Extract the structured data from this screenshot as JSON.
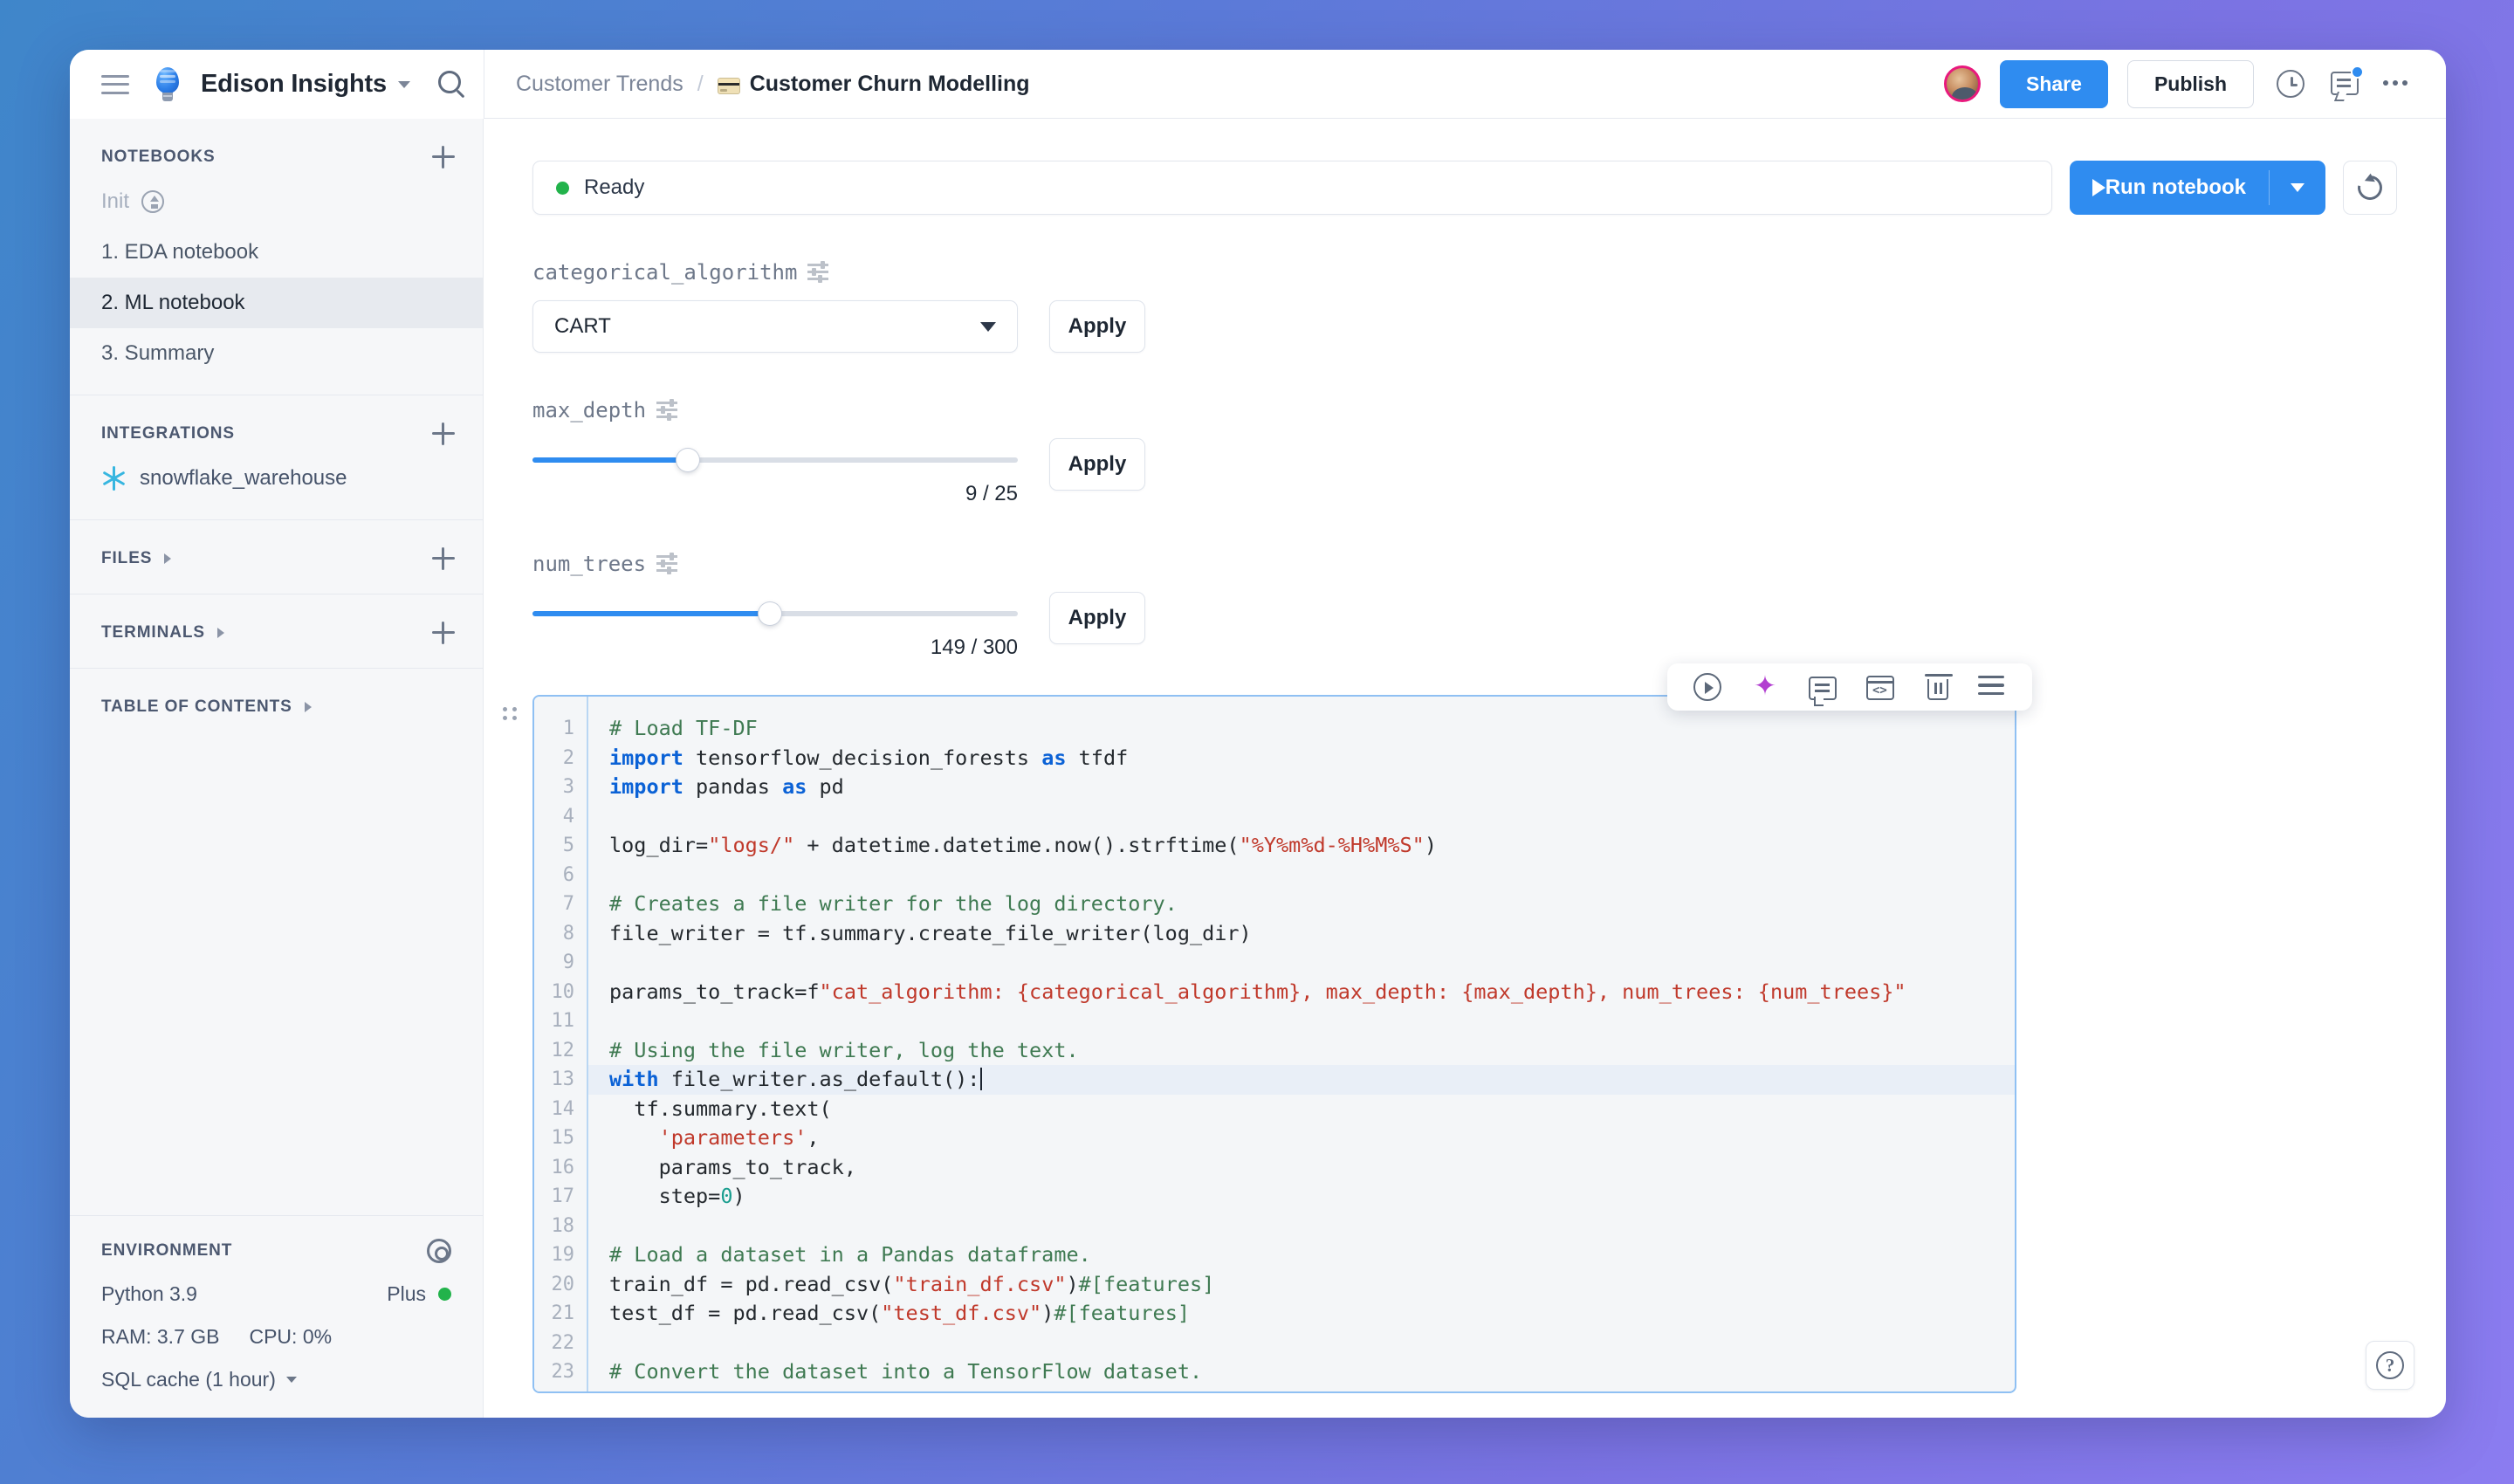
{
  "app": {
    "brand_name": "Edison Insights",
    "logo_icon": "lightbulb-icon",
    "menu_icon": "hamburger-icon",
    "search_icon": "search-icon"
  },
  "breadcrumb": {
    "parent": "Customer Trends",
    "separator": "/",
    "current": "Customer Churn Modelling",
    "current_icon": "credit-card-emoji"
  },
  "topbar_actions": {
    "avatar": "user-avatar",
    "share_label": "Share",
    "publish_label": "Publish",
    "history_icon": "clock-icon",
    "comments_icon": "comment-icon",
    "more_icon": "more-horizontal-icon"
  },
  "sidebar": {
    "notebooks": {
      "title": "NOTEBOOKS",
      "add_icon": "plus-icon",
      "items": [
        {
          "label": "Init",
          "icon": "lightning-circle-icon",
          "state": "muted"
        },
        {
          "label": "1. EDA notebook",
          "state": "normal"
        },
        {
          "label": "2. ML notebook",
          "state": "active"
        },
        {
          "label": "3. Summary",
          "state": "normal"
        }
      ]
    },
    "integrations": {
      "title": "INTEGRATIONS",
      "add_icon": "plus-icon",
      "items": [
        {
          "label": "snowflake_warehouse",
          "icon": "snowflake-icon"
        }
      ]
    },
    "files": {
      "title": "FILES",
      "chevron": "chevron-right-icon",
      "add_icon": "plus-icon"
    },
    "terminals": {
      "title": "TERMINALS",
      "chevron": "chevron-right-icon",
      "add_icon": "plus-icon"
    },
    "toc": {
      "title": "TABLE OF CONTENTS",
      "chevron": "chevron-right-icon"
    },
    "environment": {
      "title": "ENVIRONMENT",
      "settings_icon": "gear-icon",
      "python_version": "Python 3.9",
      "plan": "Plus",
      "plan_status_color": "#22b34b",
      "ram": "RAM: 3.7 GB",
      "cpu": "CPU: 0%",
      "sql_cache": "SQL cache (1 hour)"
    }
  },
  "main": {
    "status": {
      "text": "Ready",
      "color": "#22b34b"
    },
    "run_button": {
      "label": "Run notebook",
      "play_icon": "play-icon",
      "caret_icon": "chevron-down-icon"
    },
    "refresh_icon": "refresh-icon",
    "params": [
      {
        "name": "categorical_algorithm",
        "settings_icon": "sliders-icon",
        "type": "select",
        "value": "CART",
        "apply_label": "Apply"
      },
      {
        "name": "max_depth",
        "settings_icon": "sliders-icon",
        "type": "slider",
        "value": 9,
        "max": 25,
        "display": "9 / 25",
        "fill_percent": 32,
        "apply_label": "Apply"
      },
      {
        "name": "num_trees",
        "settings_icon": "sliders-icon",
        "type": "slider",
        "value": 149,
        "max": 300,
        "display": "149 / 300",
        "fill_percent": 49,
        "apply_label": "Apply"
      }
    ],
    "cell_toolbar": [
      {
        "icon": "run-cell-icon"
      },
      {
        "icon": "ai-sparkles-icon",
        "color": "#b23fd0"
      },
      {
        "icon": "comment-icon"
      },
      {
        "icon": "code-block-icon"
      },
      {
        "icon": "trash-icon"
      },
      {
        "icon": "cell-menu-icon"
      }
    ],
    "drag_handle_icon": "drag-grip-icon",
    "code_lines": [
      {
        "n": 1,
        "text": "# Load TF-DF"
      },
      {
        "n": 2,
        "text": "import tensorflow_decision_forests as tfdf"
      },
      {
        "n": 3,
        "text": "import pandas as pd"
      },
      {
        "n": 4,
        "text": ""
      },
      {
        "n": 5,
        "text": "log_dir=\"logs/\" + datetime.datetime.now().strftime(\"%Y%m%d-%H%M%S\")"
      },
      {
        "n": 6,
        "text": ""
      },
      {
        "n": 7,
        "text": "# Creates a file writer for the log directory."
      },
      {
        "n": 8,
        "text": "file_writer = tf.summary.create_file_writer(log_dir)"
      },
      {
        "n": 9,
        "text": ""
      },
      {
        "n": 10,
        "text": "params_to_track=f\"cat_algorithm: {categorical_algorithm}, max_depth: {max_depth}, num_trees: {num_trees}\""
      },
      {
        "n": 11,
        "text": ""
      },
      {
        "n": 12,
        "text": "# Using the file writer, log the text."
      },
      {
        "n": 13,
        "text": "with file_writer.as_default():"
      },
      {
        "n": 14,
        "text": "  tf.summary.text("
      },
      {
        "n": 15,
        "text": "    'parameters',"
      },
      {
        "n": 16,
        "text": "    params_to_track,"
      },
      {
        "n": 17,
        "text": "    step=0)"
      },
      {
        "n": 18,
        "text": ""
      },
      {
        "n": 19,
        "text": "# Load a dataset in a Pandas dataframe."
      },
      {
        "n": 20,
        "text": "train_df = pd.read_csv(\"train_df.csv\")#[features]"
      },
      {
        "n": 21,
        "text": "test_df = pd.read_csv(\"test_df.csv\")#[features]"
      },
      {
        "n": 22,
        "text": ""
      },
      {
        "n": 23,
        "text": "# Convert the dataset into a TensorFlow dataset."
      }
    ],
    "active_line": 13,
    "help_icon": "question-mark-icon"
  }
}
